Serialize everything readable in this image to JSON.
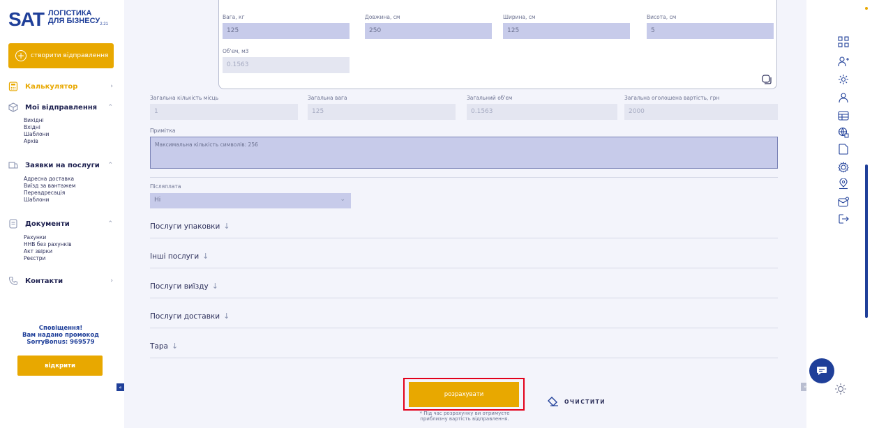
{
  "brand": {
    "sat": "SAT",
    "line1": "ЛОГІСТИКА",
    "line2": "ДЛЯ БІЗНЕСУ",
    "version": "2.21"
  },
  "sidebar": {
    "create_label": "створити відправлення",
    "items": [
      {
        "label": "Калькулятор",
        "icon": "calculator-icon",
        "active": true
      },
      {
        "label": "Мої відправлення",
        "icon": "box-icon",
        "subs": [
          "Вихідні",
          "Вхідні",
          "Шаблони",
          "Архів"
        ]
      },
      {
        "label": "Заявки на послуги",
        "icon": "request-icon",
        "subs": [
          "Адресна доставка",
          "Виїзд за вантажем",
          "Переадресація",
          "Шаблони"
        ]
      },
      {
        "label": "Документи",
        "icon": "document-icon",
        "subs": [
          "Рахунки",
          "ННВ без рахунків",
          "Акт звірки",
          "Реєстри"
        ]
      },
      {
        "label": "Контакти",
        "icon": "phone-icon"
      }
    ],
    "notice": [
      "Сповіщення!",
      "Вам надано промокод",
      "SorryBonus: 969579"
    ],
    "open_label": "відкрити",
    "collapse_label": "«"
  },
  "cargo": {
    "weight_label": "Вага, кг",
    "weight": "125",
    "length_label": "Довжина, см",
    "length": "250",
    "width_label": "Ширина, см",
    "width": "125",
    "height_label": "Висота, см",
    "height": "5",
    "volume_label": "Об'єм, м3",
    "volume": "0.1563"
  },
  "totals": {
    "places_label": "Загальна кількість місць",
    "places": "1",
    "weight_label": "Загальна вага",
    "weight": "125",
    "volume_label": "Загальний об'єм",
    "volume": "0.1563",
    "value_label": "Загальна оголошена вартість, грн",
    "value": "2000"
  },
  "note": {
    "label": "Примітка",
    "placeholder": "Максимальна кількість символів: 256"
  },
  "cod": {
    "label": "Післяплата",
    "value": "Ні"
  },
  "sections": [
    "Послуги упаковки",
    "Інші послуги",
    "Послуги виїзду",
    "Послуги доставки",
    "Тара"
  ],
  "actions": {
    "calculate": "розрахувати",
    "clear": "ОЧИСТИТИ",
    "note_line1": "* Під час розрахунку ви отримуєте",
    "note_line2": "приблизну вартість відправлення."
  },
  "rail_icons": [
    "contracts-icon",
    "add-user-icon",
    "settings-icon",
    "user-icon",
    "table-icon",
    "globe-icon",
    "file-icon",
    "gear-icon",
    "location-icon",
    "mail-icon",
    "logout-icon"
  ],
  "colors": {
    "accent": "#e8a800",
    "brand": "#1f3f99",
    "field": "#c7cbea",
    "highlight": "#e2001a"
  }
}
